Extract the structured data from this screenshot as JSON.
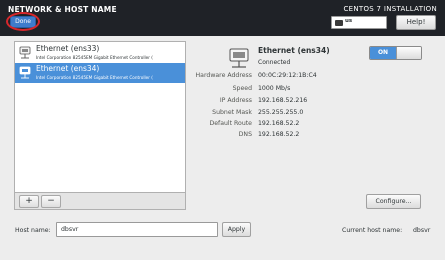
{
  "header": {
    "title": "NETWORK & HOST NAME",
    "done_label": "Done",
    "installer_title": "CENTOS 7 INSTALLATION",
    "keyboard_layout": "us",
    "help_label": "Help!"
  },
  "devices": [
    {
      "name": "Ethernet (ens33)",
      "description": "Intel Corporation 82545EM Gigabit Ethernet Controller (",
      "selected": false
    },
    {
      "name": "Ethernet (ens34)",
      "description": "Intel Corporation 82545EM Gigabit Ethernet Controller (",
      "selected": true
    }
  ],
  "list_toolbar": {
    "add_label": "+",
    "remove_label": "−"
  },
  "detail": {
    "title": "Ethernet (ens34)",
    "status": "Connected",
    "toggle_label": "ON",
    "toggle_state": "on",
    "properties": [
      {
        "label": "Hardware Address",
        "value": "00:0C:29:12:1B:C4"
      },
      {
        "label": "Speed",
        "value": "1000 Mb/s"
      },
      {
        "label": "IP Address",
        "value": "192.168.52.216"
      },
      {
        "label": "Subnet Mask",
        "value": "255.255.255.0"
      },
      {
        "label": "Default Route",
        "value": "192.168.52.2"
      },
      {
        "label": "DNS",
        "value": "192.168.52.2"
      }
    ],
    "configure_label": "Configure..."
  },
  "hostname": {
    "label": "Host name:",
    "value": "dbsvr",
    "apply_label": "Apply",
    "current_label": "Current host name:",
    "current_value": "dbsvr"
  },
  "colors": {
    "accent": "#4a90d9",
    "header_bg": "#1f2227",
    "highlight_ring": "#d6272c"
  }
}
